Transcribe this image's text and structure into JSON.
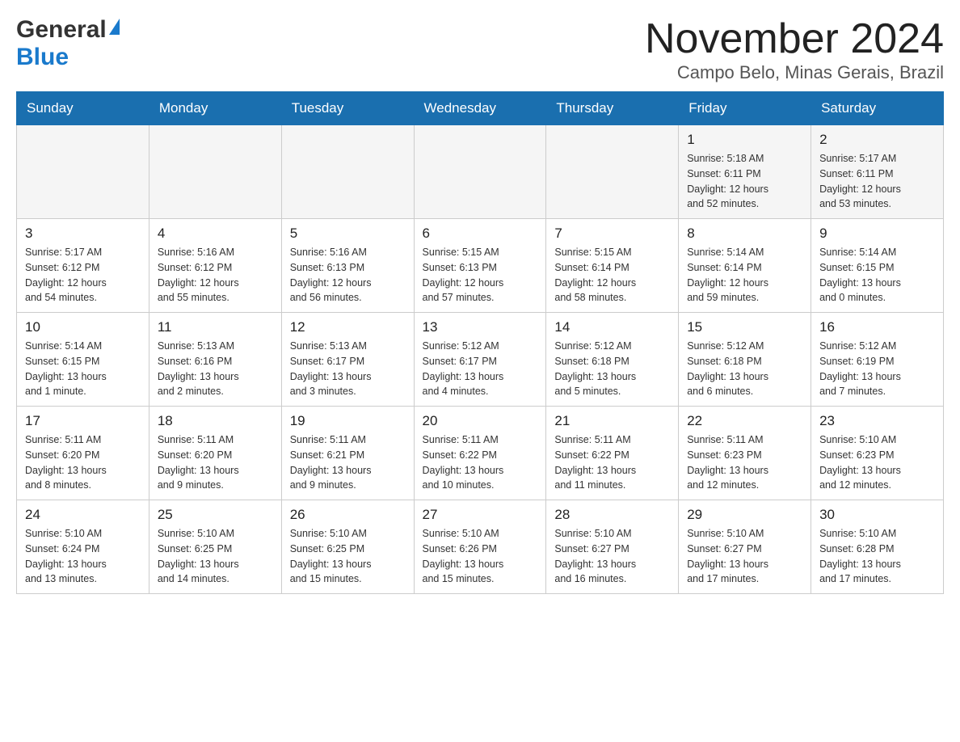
{
  "header": {
    "title": "November 2024",
    "subtitle": "Campo Belo, Minas Gerais, Brazil",
    "logo_general": "General",
    "logo_blue": "Blue"
  },
  "weekdays": [
    "Sunday",
    "Monday",
    "Tuesday",
    "Wednesday",
    "Thursday",
    "Friday",
    "Saturday"
  ],
  "weeks": [
    [
      {
        "day": "",
        "info": ""
      },
      {
        "day": "",
        "info": ""
      },
      {
        "day": "",
        "info": ""
      },
      {
        "day": "",
        "info": ""
      },
      {
        "day": "",
        "info": ""
      },
      {
        "day": "1",
        "info": "Sunrise: 5:18 AM\nSunset: 6:11 PM\nDaylight: 12 hours\nand 52 minutes."
      },
      {
        "day": "2",
        "info": "Sunrise: 5:17 AM\nSunset: 6:11 PM\nDaylight: 12 hours\nand 53 minutes."
      }
    ],
    [
      {
        "day": "3",
        "info": "Sunrise: 5:17 AM\nSunset: 6:12 PM\nDaylight: 12 hours\nand 54 minutes."
      },
      {
        "day": "4",
        "info": "Sunrise: 5:16 AM\nSunset: 6:12 PM\nDaylight: 12 hours\nand 55 minutes."
      },
      {
        "day": "5",
        "info": "Sunrise: 5:16 AM\nSunset: 6:13 PM\nDaylight: 12 hours\nand 56 minutes."
      },
      {
        "day": "6",
        "info": "Sunrise: 5:15 AM\nSunset: 6:13 PM\nDaylight: 12 hours\nand 57 minutes."
      },
      {
        "day": "7",
        "info": "Sunrise: 5:15 AM\nSunset: 6:14 PM\nDaylight: 12 hours\nand 58 minutes."
      },
      {
        "day": "8",
        "info": "Sunrise: 5:14 AM\nSunset: 6:14 PM\nDaylight: 12 hours\nand 59 minutes."
      },
      {
        "day": "9",
        "info": "Sunrise: 5:14 AM\nSunset: 6:15 PM\nDaylight: 13 hours\nand 0 minutes."
      }
    ],
    [
      {
        "day": "10",
        "info": "Sunrise: 5:14 AM\nSunset: 6:15 PM\nDaylight: 13 hours\nand 1 minute."
      },
      {
        "day": "11",
        "info": "Sunrise: 5:13 AM\nSunset: 6:16 PM\nDaylight: 13 hours\nand 2 minutes."
      },
      {
        "day": "12",
        "info": "Sunrise: 5:13 AM\nSunset: 6:17 PM\nDaylight: 13 hours\nand 3 minutes."
      },
      {
        "day": "13",
        "info": "Sunrise: 5:12 AM\nSunset: 6:17 PM\nDaylight: 13 hours\nand 4 minutes."
      },
      {
        "day": "14",
        "info": "Sunrise: 5:12 AM\nSunset: 6:18 PM\nDaylight: 13 hours\nand 5 minutes."
      },
      {
        "day": "15",
        "info": "Sunrise: 5:12 AM\nSunset: 6:18 PM\nDaylight: 13 hours\nand 6 minutes."
      },
      {
        "day": "16",
        "info": "Sunrise: 5:12 AM\nSunset: 6:19 PM\nDaylight: 13 hours\nand 7 minutes."
      }
    ],
    [
      {
        "day": "17",
        "info": "Sunrise: 5:11 AM\nSunset: 6:20 PM\nDaylight: 13 hours\nand 8 minutes."
      },
      {
        "day": "18",
        "info": "Sunrise: 5:11 AM\nSunset: 6:20 PM\nDaylight: 13 hours\nand 9 minutes."
      },
      {
        "day": "19",
        "info": "Sunrise: 5:11 AM\nSunset: 6:21 PM\nDaylight: 13 hours\nand 9 minutes."
      },
      {
        "day": "20",
        "info": "Sunrise: 5:11 AM\nSunset: 6:22 PM\nDaylight: 13 hours\nand 10 minutes."
      },
      {
        "day": "21",
        "info": "Sunrise: 5:11 AM\nSunset: 6:22 PM\nDaylight: 13 hours\nand 11 minutes."
      },
      {
        "day": "22",
        "info": "Sunrise: 5:11 AM\nSunset: 6:23 PM\nDaylight: 13 hours\nand 12 minutes."
      },
      {
        "day": "23",
        "info": "Sunrise: 5:10 AM\nSunset: 6:23 PM\nDaylight: 13 hours\nand 12 minutes."
      }
    ],
    [
      {
        "day": "24",
        "info": "Sunrise: 5:10 AM\nSunset: 6:24 PM\nDaylight: 13 hours\nand 13 minutes."
      },
      {
        "day": "25",
        "info": "Sunrise: 5:10 AM\nSunset: 6:25 PM\nDaylight: 13 hours\nand 14 minutes."
      },
      {
        "day": "26",
        "info": "Sunrise: 5:10 AM\nSunset: 6:25 PM\nDaylight: 13 hours\nand 15 minutes."
      },
      {
        "day": "27",
        "info": "Sunrise: 5:10 AM\nSunset: 6:26 PM\nDaylight: 13 hours\nand 15 minutes."
      },
      {
        "day": "28",
        "info": "Sunrise: 5:10 AM\nSunset: 6:27 PM\nDaylight: 13 hours\nand 16 minutes."
      },
      {
        "day": "29",
        "info": "Sunrise: 5:10 AM\nSunset: 6:27 PM\nDaylight: 13 hours\nand 17 minutes."
      },
      {
        "day": "30",
        "info": "Sunrise: 5:10 AM\nSunset: 6:28 PM\nDaylight: 13 hours\nand 17 minutes."
      }
    ]
  ]
}
